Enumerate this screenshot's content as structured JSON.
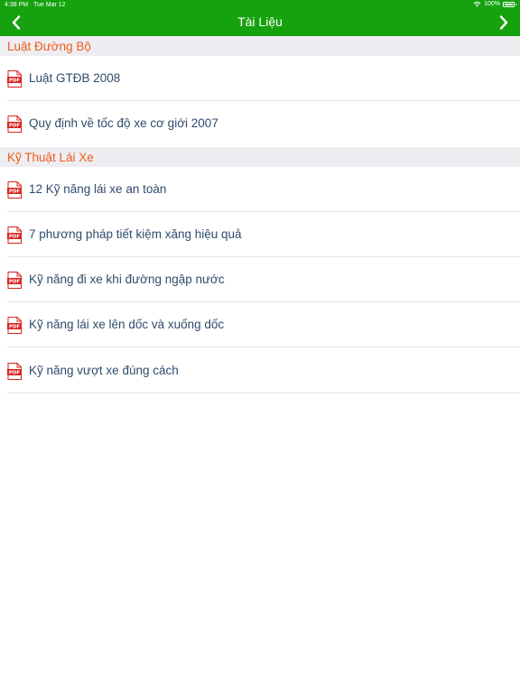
{
  "status_bar": {
    "time": "4:38 PM",
    "date": "Tue Mar 12",
    "battery": "100%"
  },
  "nav": {
    "title": "Tài Liệu",
    "back_icon": "chevron-left",
    "forward_icon": "chevron-right"
  },
  "colors": {
    "nav_bg": "#16a20f",
    "section_title": "#ee5b16",
    "row_text": "#2f4b6d",
    "pdf_icon": "#d8231e"
  },
  "sections": [
    {
      "title": "Luật Đường Bộ",
      "items": [
        {
          "icon": "pdf-icon",
          "icon_text": "PDF",
          "label": "Luật GTĐB 2008"
        },
        {
          "icon": "pdf-icon",
          "icon_text": "PDF",
          "label": "Quy định về tốc độ xe cơ giới 2007"
        }
      ]
    },
    {
      "title": "Kỹ Thuật Lái Xe",
      "items": [
        {
          "icon": "pdf-icon",
          "icon_text": "PDF",
          "label": "12 Kỹ năng lái xe an toàn"
        },
        {
          "icon": "pdf-icon",
          "icon_text": "PDF",
          "label": "7 phương pháp tiết kiệm xăng hiệu quả"
        },
        {
          "icon": "pdf-icon",
          "icon_text": "PDF",
          "label": "Kỹ năng đi xe khi đường ngập nước"
        },
        {
          "icon": "pdf-icon",
          "icon_text": "PDF",
          "label": "Kỹ năng lái xe lên dốc và xuống dốc"
        },
        {
          "icon": "pdf-icon",
          "icon_text": "PDF",
          "label": "Kỹ năng vượt xe đúng cách"
        }
      ]
    }
  ]
}
